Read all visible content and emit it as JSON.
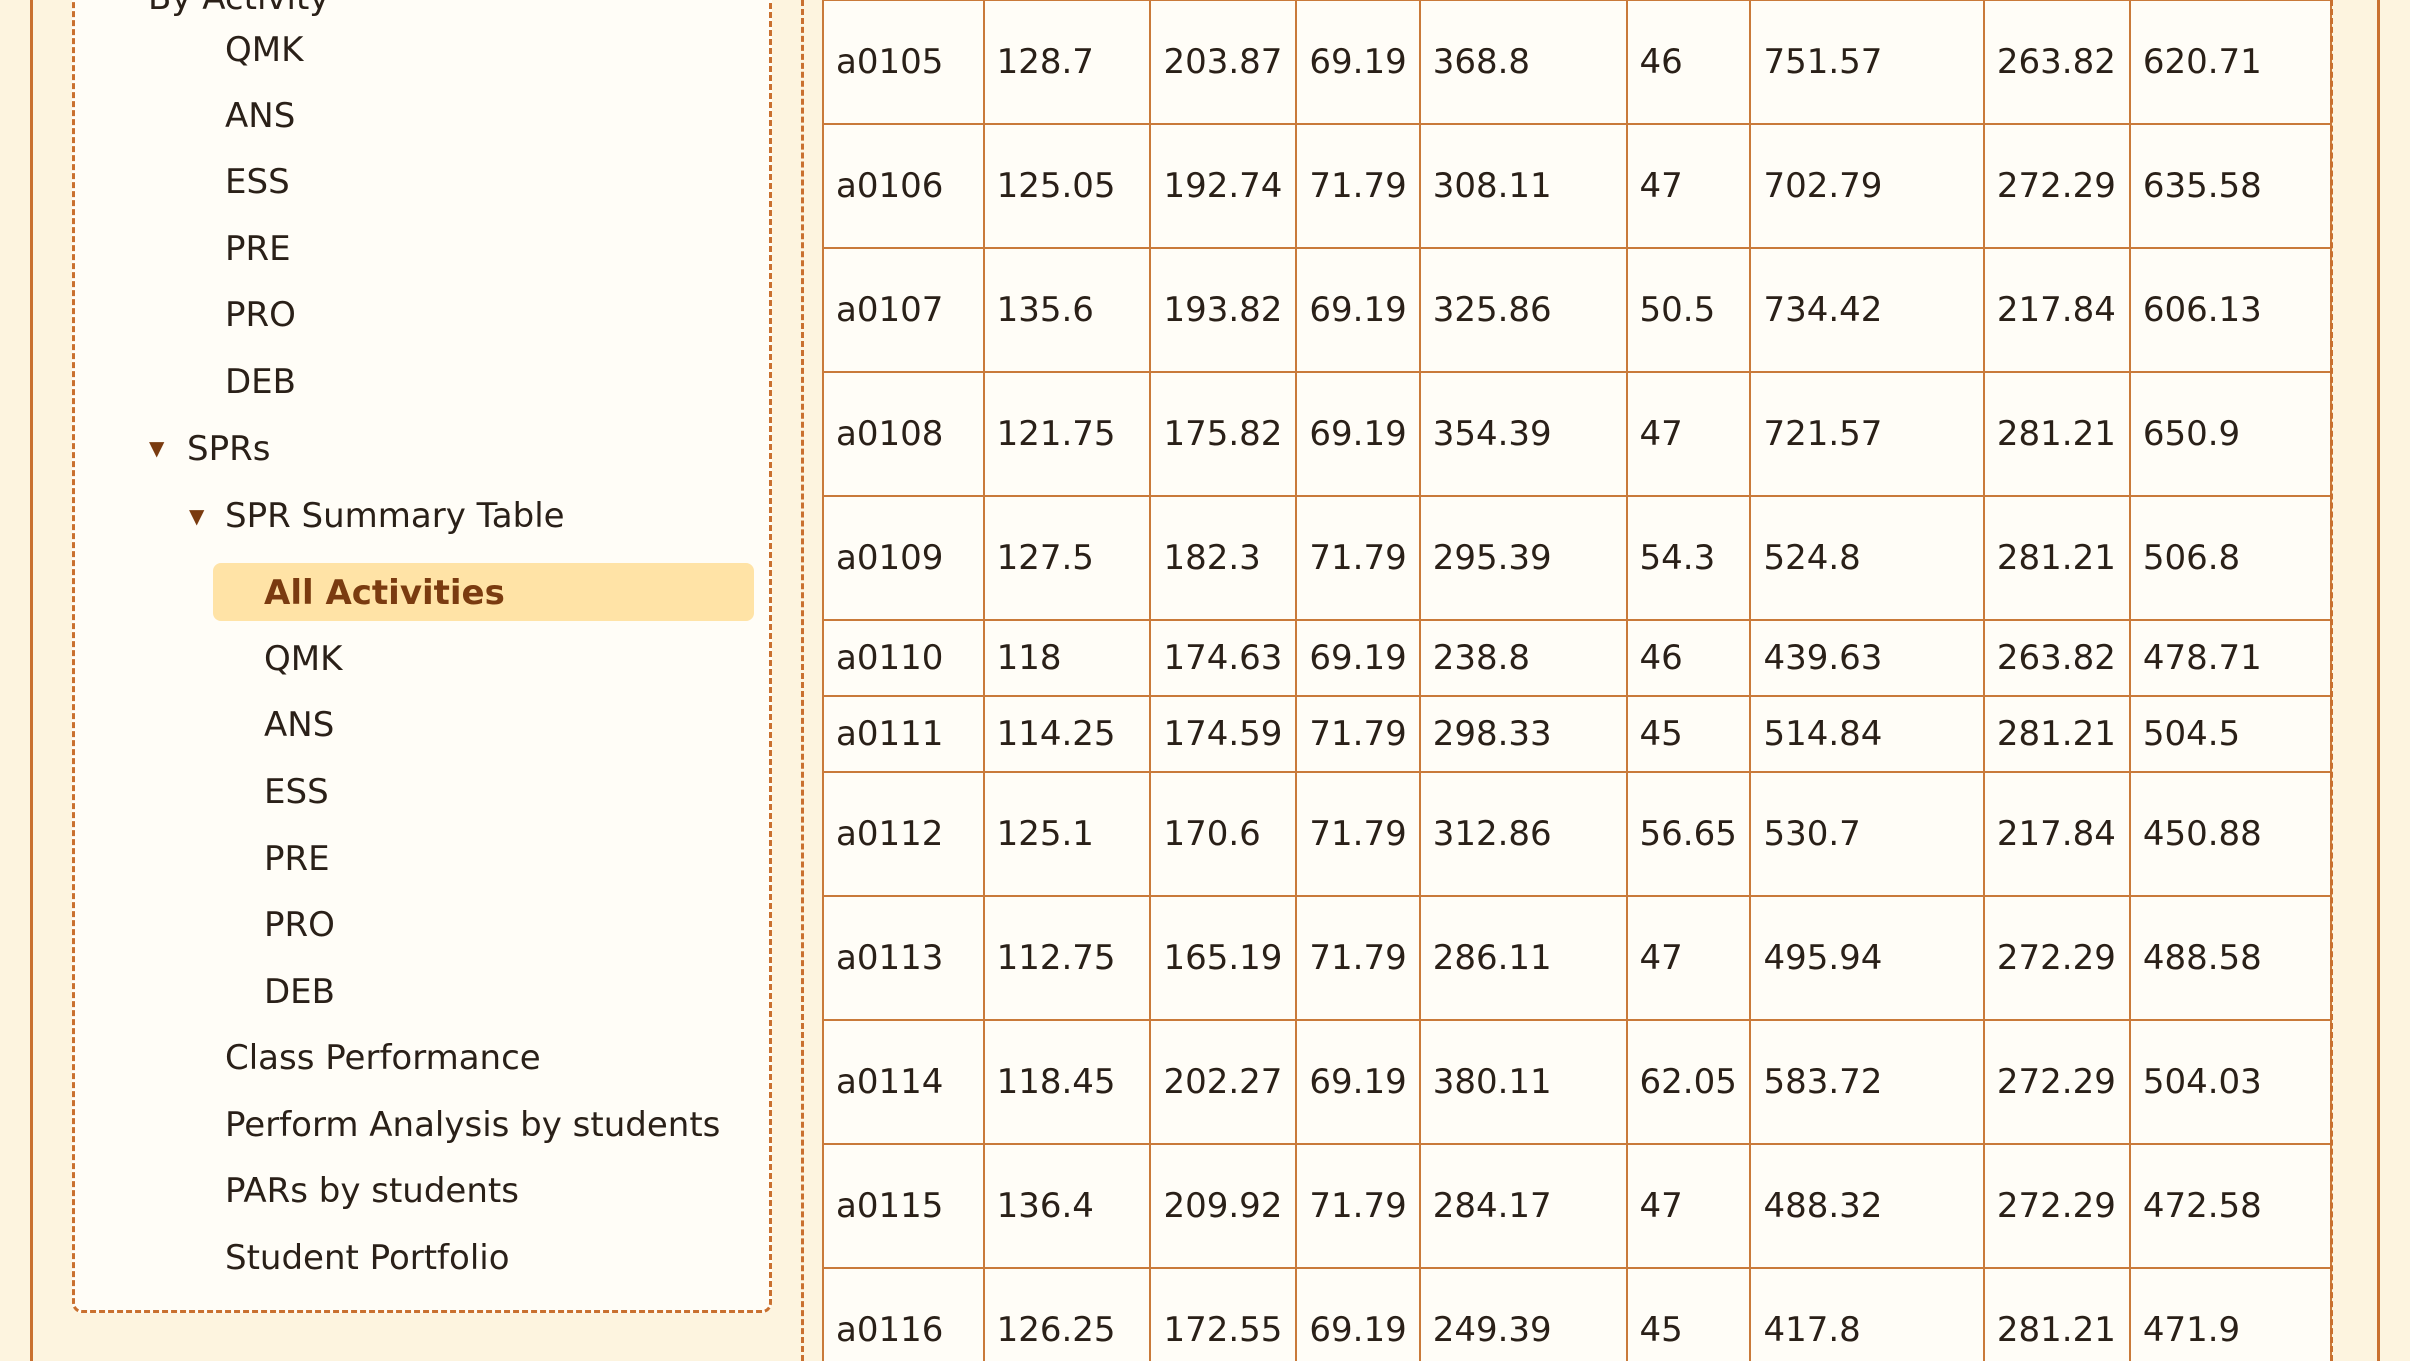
{
  "sidebar": {
    "top_partial_label": "By Activity",
    "by_activity_items": [
      "QMK",
      "ANS",
      "ESS",
      "PRE",
      "PRO",
      "DEB"
    ],
    "sprs_label": "SPRs",
    "spr_summary_label": "SPR Summary Table",
    "spr_items": [
      "All Activities",
      "QMK",
      "ANS",
      "ESS",
      "PRE",
      "PRO",
      "DEB"
    ],
    "bottom_items": [
      "Class Performance",
      "Perform Analysis by students",
      "PARs by students",
      "Student Portfolio"
    ]
  },
  "table": {
    "rows": [
      [
        "a0105",
        "128.7",
        "203.87",
        "69.19",
        "368.8",
        "46",
        "751.57",
        "263.82",
        "620.71"
      ],
      [
        "a0106",
        "125.05",
        "192.74",
        "71.79",
        "308.11",
        "47",
        "702.79",
        "272.29",
        "635.58"
      ],
      [
        "a0107",
        "135.6",
        "193.82",
        "69.19",
        "325.86",
        "50.5",
        "734.42",
        "217.84",
        "606.13"
      ],
      [
        "a0108",
        "121.75",
        "175.82",
        "69.19",
        "354.39",
        "47",
        "721.57",
        "281.21",
        "650.9"
      ],
      [
        "a0109",
        "127.5",
        "182.3",
        "71.79",
        "295.39",
        "54.3",
        "524.8",
        "281.21",
        "506.8"
      ],
      [
        "a0110",
        "118",
        "174.63",
        "69.19",
        "238.8",
        "46",
        "439.63",
        "263.82",
        "478.71"
      ],
      [
        "a0111",
        "114.25",
        "174.59",
        "71.79",
        "298.33",
        "45",
        "514.84",
        "281.21",
        "504.5"
      ],
      [
        "a0112",
        "125.1",
        "170.6",
        "71.79",
        "312.86",
        "56.65",
        "530.7",
        "217.84",
        "450.88"
      ],
      [
        "a0113",
        "112.75",
        "165.19",
        "71.79",
        "286.11",
        "47",
        "495.94",
        "272.29",
        "488.58"
      ],
      [
        "a0114",
        "118.45",
        "202.27",
        "69.19",
        "380.11",
        "62.05",
        "583.72",
        "272.29",
        "504.03"
      ],
      [
        "a0115",
        "136.4",
        "209.92",
        "71.79",
        "284.17",
        "47",
        "488.32",
        "272.29",
        "472.58"
      ],
      [
        "a0116",
        "126.25",
        "172.55",
        "69.19",
        "249.39",
        "45",
        "417.8",
        "281.21",
        "471.9"
      ]
    ]
  },
  "colors": {
    "accent": "#c9702f",
    "highlight": "#ffe3a6",
    "background": "#fdf4df"
  }
}
